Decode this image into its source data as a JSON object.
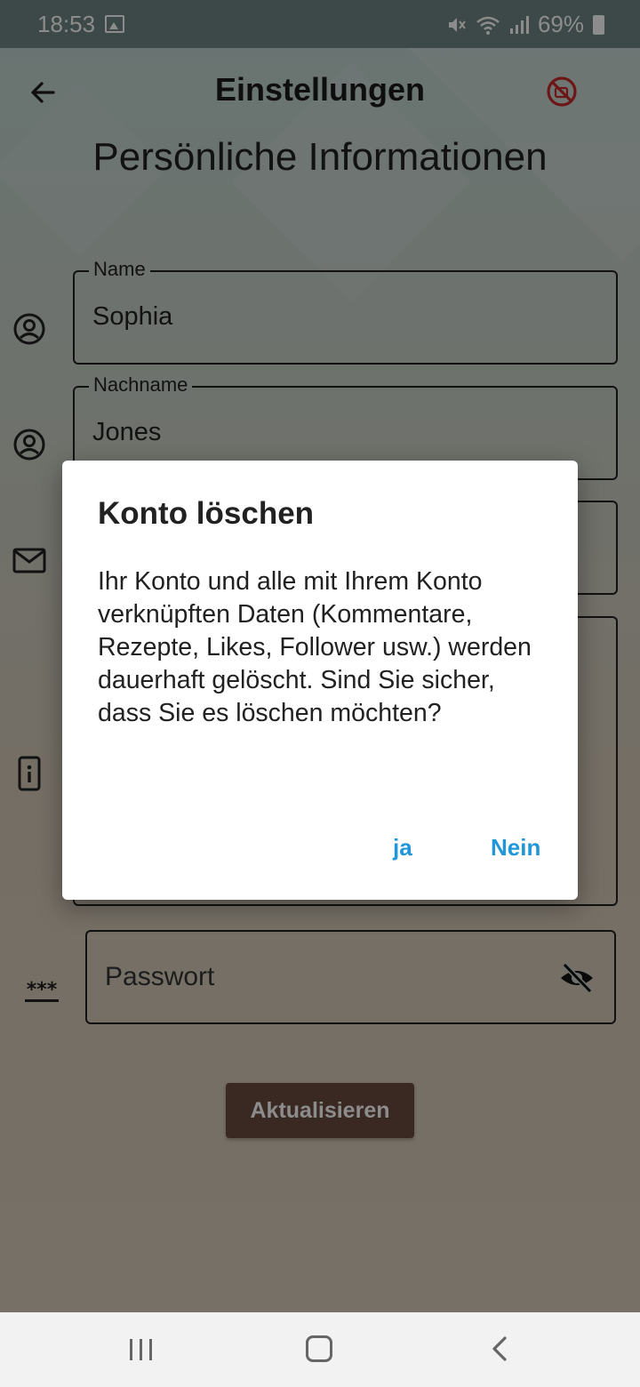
{
  "status_bar": {
    "time": "18:53",
    "battery_percent": "69%",
    "icons": [
      "gallery-icon",
      "mute-icon",
      "wifi-icon",
      "signal-icon",
      "battery-icon"
    ]
  },
  "app_bar": {
    "title": "Einstellungen",
    "back_icon": "arrow-back-icon",
    "action_icon": "no-camera-icon",
    "action_color": "#c62828"
  },
  "page": {
    "title": "Persönliche Informationen"
  },
  "form": {
    "name": {
      "label": "Name",
      "value": "Sophia",
      "icon": "account-circle-icon"
    },
    "lastname": {
      "label": "Nachname",
      "value": "Jones",
      "icon": "account-circle-icon"
    },
    "email": {
      "icon": "mail-icon"
    },
    "info": {
      "icon": "info-device-icon"
    },
    "password": {
      "placeholder": "Passwort",
      "icon": "password-icon",
      "toggle_icon": "eye-off-icon"
    },
    "update_button": "Aktualisieren"
  },
  "dialog": {
    "title": "Konto löschen",
    "body": "Ihr Konto und alle mit Ihrem Konto verknüpften Daten (Kommentare, Rezepte, Likes, Follower usw.) werden dauerhaft gelöscht. Sind Sie sicher, dass Sie es löschen möchten?",
    "confirm": "ja",
    "cancel": "Nein",
    "button_color": "#2196d8"
  },
  "nav_bar": {
    "icons": [
      "recents-icon",
      "home-icon",
      "back-icon"
    ]
  }
}
